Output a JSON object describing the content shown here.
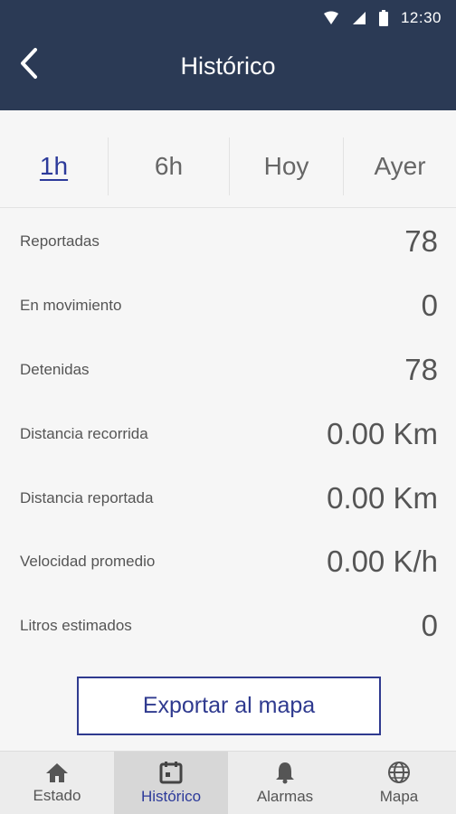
{
  "status_bar": {
    "time": "12:30",
    "icons": [
      "wifi-icon",
      "signal-icon",
      "battery-icon"
    ],
    "background": "#2b3a55"
  },
  "header": {
    "title": "Histórico",
    "back_icon": "back-arrow-icon"
  },
  "tabs": [
    {
      "label": "1h",
      "active": true
    },
    {
      "label": "6h",
      "active": false
    },
    {
      "label": "Hoy",
      "active": false
    },
    {
      "label": "Ayer",
      "active": false
    }
  ],
  "stats": [
    {
      "label": "Reportadas",
      "value": "78"
    },
    {
      "label": "En movimiento",
      "value": "0"
    },
    {
      "label": "Detenidas",
      "value": "78"
    },
    {
      "label": "Distancia recorrida",
      "value": "0.00 Km"
    },
    {
      "label": "Distancia reportada",
      "value": "0.00 Km"
    },
    {
      "label": "Velocidad promedio",
      "value": "0.00 K/h"
    },
    {
      "label": "Litros estimados",
      "value": "0"
    }
  ],
  "export_button": {
    "label": "Exportar al mapa"
  },
  "bottom_nav": [
    {
      "label": "Estado",
      "icon": "home-icon",
      "active": false
    },
    {
      "label": "Histórico",
      "icon": "calendar-icon",
      "active": true
    },
    {
      "label": "Alarmas",
      "icon": "bell-icon",
      "active": false
    },
    {
      "label": "Mapa",
      "icon": "globe-icon",
      "active": false
    }
  ],
  "colors": {
    "header": "#2b3a55",
    "accent": "#2c3a9a",
    "text": "#555555",
    "background": "#f6f6f6"
  }
}
